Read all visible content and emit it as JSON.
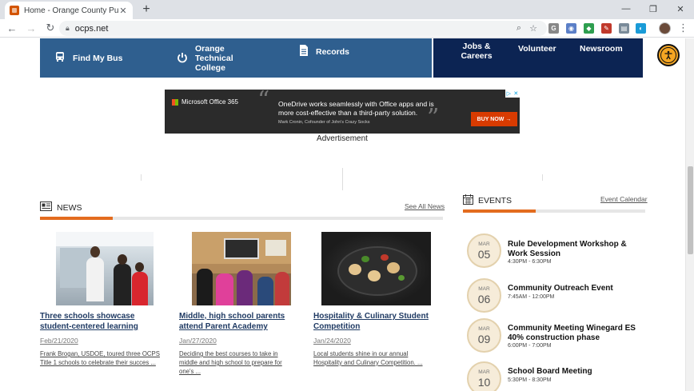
{
  "browser": {
    "tab_title": "Home - Orange County Public Sc",
    "tab_close": "✕",
    "new_tab": "+",
    "url": "ocps.net",
    "window_controls": [
      "—",
      "❐",
      "✕"
    ],
    "extensions": [
      {
        "label": "G",
        "color": "#888888"
      },
      {
        "label": "◉",
        "color": "#5b7fc7"
      },
      {
        "label": "◆",
        "color": "#2e9e4f"
      },
      {
        "label": "✎",
        "color": "#c0392b"
      },
      {
        "label": "▤",
        "color": "#7a8b99"
      },
      {
        "label": "◐",
        "color": "#1a9bd7"
      },
      {
        "label": "●",
        "color": "#17b7a0"
      }
    ]
  },
  "quicklinks": [
    {
      "label": "Find My Bus",
      "icon": "bus-icon"
    },
    {
      "label": "Orange Technical College",
      "icon": "power-icon"
    },
    {
      "label": "Records",
      "icon": "document-icon"
    }
  ],
  "navlinks": [
    {
      "label": "Jobs & Careers"
    },
    {
      "label": "Volunteer"
    },
    {
      "label": "Newsroom"
    }
  ],
  "ad": {
    "brand": "Microsoft Office 365",
    "message": "OneDrive works seamlessly with Office apps and is more cost-effective than a third-party solution.",
    "cite": "Mark Cronin, Cofounder of John's Crazy Socks",
    "cta": "BUY NOW →",
    "label": "Advertisement"
  },
  "news": {
    "heading": "NEWS",
    "see_all": "See All News",
    "progress": 0.18,
    "items": [
      {
        "headline": "Three schools showcase student-centered learning",
        "date": "Feb/21/2020",
        "excerpt": "Frank Brogan, USDOE, toured three OCPS Title 1 schools to celebrate their succes ..."
      },
      {
        "headline": "Middle, high school parents attend Parent Academy",
        "date": "Jan/27/2020",
        "excerpt": "Deciding the best courses to take in middle and high school to prepare for one's ..."
      },
      {
        "headline": "Hospitality & Culinary Student Competition",
        "date": "Jan/24/2020",
        "excerpt": "Local students shine in our annual Hospitality and Culinary Competition. ..."
      }
    ]
  },
  "events": {
    "heading": "EVENTS",
    "calendar_link": "Event Calendar",
    "progress": 0.4,
    "items": [
      {
        "month": "MAR",
        "day": "05",
        "title": "Rule Development Workshop & Work Session",
        "time": "4:30PM - 6:30PM"
      },
      {
        "month": "MAR",
        "day": "06",
        "title": "Community Outreach Event",
        "time": "7:45AM - 12:00PM"
      },
      {
        "month": "MAR",
        "day": "09",
        "title": "Community Meeting Winegard ES 40% construction phase",
        "time": "6:00PM - 7:00PM"
      },
      {
        "month": "MAR",
        "day": "10",
        "title": "School Board Meeting",
        "time": "5:30PM - 8:30PM"
      }
    ]
  }
}
